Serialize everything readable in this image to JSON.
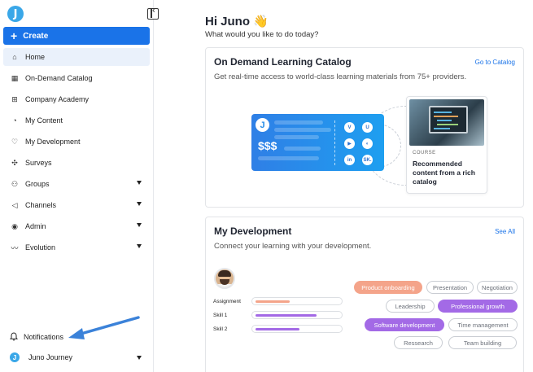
{
  "app": {
    "logo_letter": "J"
  },
  "sidebar": {
    "create_label": "Create",
    "items": [
      {
        "label": "Home",
        "icon": "home-icon",
        "glyph": "⌂",
        "active": true,
        "expandable": false
      },
      {
        "label": "On-Demand Catalog",
        "icon": "catalog-icon",
        "glyph": "▦",
        "active": false,
        "expandable": false
      },
      {
        "label": "Company Academy",
        "icon": "academy-icon",
        "glyph": "⊞",
        "active": false,
        "expandable": false
      },
      {
        "label": "My Content",
        "icon": "content-icon",
        "glyph": "◔",
        "active": false,
        "expandable": false
      },
      {
        "label": "My Development",
        "icon": "development-icon",
        "glyph": "♡",
        "active": false,
        "expandable": false
      },
      {
        "label": "Surveys",
        "icon": "surveys-icon",
        "glyph": "✣",
        "active": false,
        "expandable": false
      },
      {
        "label": "Groups",
        "icon": "groups-icon",
        "glyph": "⚇",
        "active": false,
        "expandable": true
      },
      {
        "label": "Channels",
        "icon": "channels-icon",
        "glyph": "◁",
        "active": false,
        "expandable": true
      },
      {
        "label": "Admin",
        "icon": "admin-icon",
        "glyph": "◉",
        "active": false,
        "expandable": true
      },
      {
        "label": "Evolution",
        "icon": "evolution-icon",
        "glyph": "〰",
        "active": false,
        "expandable": true
      }
    ],
    "notifications_label": "Notifications",
    "journey_label": "Juno Journey"
  },
  "main": {
    "greeting": "Hi Juno 👋",
    "subgreeting": "What would you like to do today?",
    "catalog_card": {
      "title": "On Demand Learning Catalog",
      "link": "Go to Catalog",
      "subtitle": "Get real-time access to world-class learning materials from 75+ providers.",
      "price_text": "$$$",
      "providers": [
        "V",
        "U",
        "▶",
        "◐",
        "in",
        "SK."
      ],
      "course_tag": "COURSE",
      "course_title": "Recommended content from a rich catalog"
    },
    "development_card": {
      "title": "My Development",
      "link": "See All",
      "subtitle": "Connect your learning with your development.",
      "skills": [
        {
          "label": "Assignment",
          "progress": 0.4,
          "color": "#f4a48a"
        },
        {
          "label": "Skill 1",
          "progress": 0.72,
          "color": "#a36ae6"
        },
        {
          "label": "Skill 2",
          "progress": 0.52,
          "color": "#a36ae6"
        }
      ],
      "chips": [
        {
          "label": "Product onboarding",
          "style": "orange"
        },
        {
          "label": "Presentation",
          "style": "outline"
        },
        {
          "label": "Negotiation",
          "style": "outline"
        },
        {
          "label": "Leadership",
          "style": "outline"
        },
        {
          "label": "Professional growth",
          "style": "purple"
        },
        {
          "label": "Software development",
          "style": "purple"
        },
        {
          "label": "Time management",
          "style": "outline"
        },
        {
          "label": "Ressearch",
          "style": "outline"
        },
        {
          "label": "Team building",
          "style": "outline"
        }
      ]
    }
  },
  "colors": {
    "accent": "#1a73e8",
    "brand": "#3aa7e8",
    "annotation_arrow": "#3b82d9"
  }
}
